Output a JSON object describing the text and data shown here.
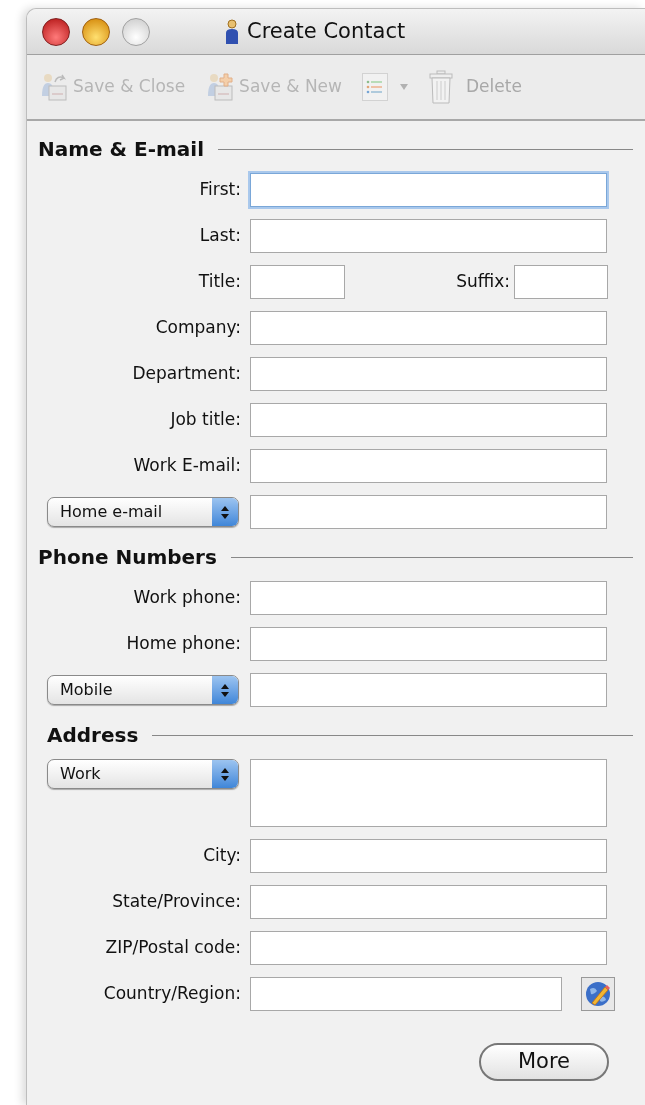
{
  "window": {
    "title": "Create Contact"
  },
  "toolbar": [
    {
      "kind": "save-close",
      "label": "Save & Close",
      "disabled": true
    },
    {
      "kind": "save-new",
      "label": "Save & New",
      "disabled": true
    },
    {
      "kind": "menu",
      "disabled": true
    },
    {
      "kind": "delete",
      "label": "Delete",
      "disabled": true
    }
  ],
  "sections": [
    {
      "title": "Name & E-mail",
      "rows": [
        {
          "kind": "field",
          "label": "First:",
          "focused": true
        },
        {
          "kind": "field",
          "label": "Last:",
          "focused": false
        },
        {
          "kind": "pair",
          "label": "Title:",
          "label_2": "Suffix:"
        },
        {
          "kind": "field",
          "label": "Company:",
          "focused": false
        },
        {
          "kind": "field",
          "label": "Department:",
          "focused": false
        },
        {
          "kind": "field",
          "label": "Job title:",
          "focused": false
        },
        {
          "kind": "field",
          "label": "Work E-mail:",
          "focused": false
        },
        {
          "kind": "popup",
          "value": "Home e-mail"
        }
      ]
    },
    {
      "title": "Phone Numbers",
      "rows": [
        {
          "kind": "field",
          "label": "Work phone:",
          "focused": false
        },
        {
          "kind": "field",
          "label": "Home phone:",
          "focused": false
        },
        {
          "kind": "popup",
          "value": "Mobile"
        }
      ]
    },
    {
      "title": "Address",
      "rows": [
        {
          "kind": "area",
          "value": "Work"
        },
        {
          "kind": "field",
          "label": "City:",
          "focused": false
        },
        {
          "kind": "field",
          "label": "State/Province:",
          "focused": false
        },
        {
          "kind": "field",
          "label": "ZIP/Postal code:",
          "focused": false
        },
        {
          "kind": "country",
          "label": "Country/Region:"
        }
      ]
    }
  ],
  "more_button": "More"
}
